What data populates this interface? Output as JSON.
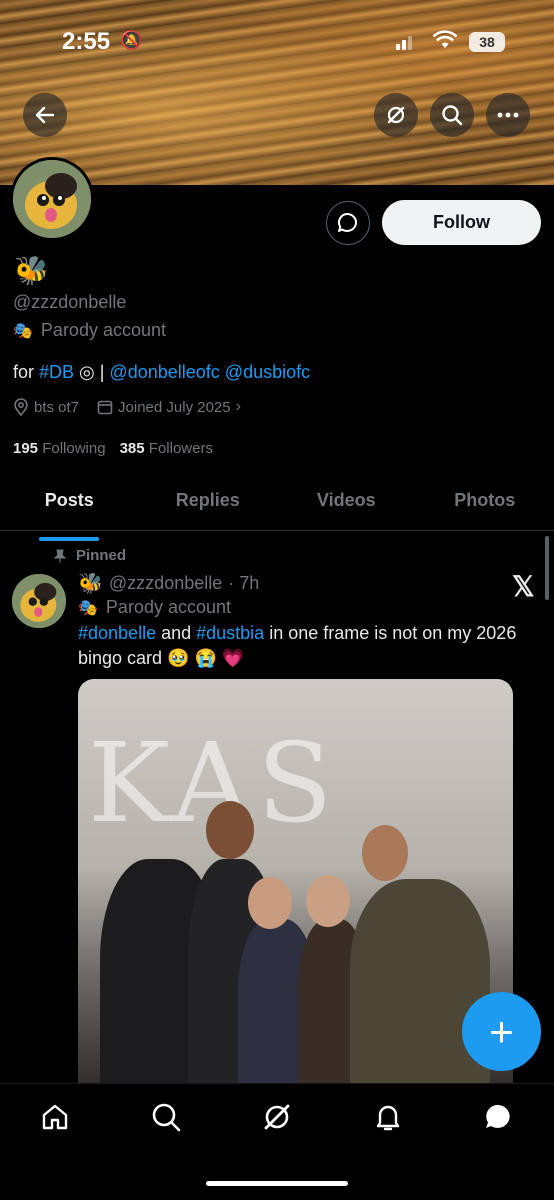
{
  "status": {
    "time": "2:55",
    "battery": "38"
  },
  "profile": {
    "display_emoji": "🐝",
    "handle": "@zzzdonbelle",
    "parody_label": "Parody account",
    "bio_prefix": "for ",
    "bio_hashtag": "#DB",
    "bio_sep": " ◎ | ",
    "bio_mention1": "@donbelleofc",
    "bio_mention2": "@dusbiofc",
    "location": "bts ot7",
    "joined": "Joined July 2025",
    "following_count": "195",
    "following_label": "Following",
    "followers_count": "385",
    "followers_label": "Followers",
    "follow_label": "Follow"
  },
  "tabs": [
    {
      "label": "Posts"
    },
    {
      "label": "Replies"
    },
    {
      "label": "Videos"
    },
    {
      "label": "Photos"
    }
  ],
  "tweet": {
    "pinned_label": "Pinned",
    "emoji": "🐝",
    "handle": "@zzzdonbelle",
    "time": "· 7h",
    "parody_label": "Parody account",
    "hashtag1": "#donbelle",
    "and": " and ",
    "hashtag2": "#dustbia",
    "text_rest": " in one frame is not on my 2026 bingo card 🥹 😭 💗",
    "photo_overlay_text": "KAS"
  },
  "fab_label": "+",
  "colors": {
    "accent": "#1d9bf0",
    "background": "#000000",
    "muted": "#71767b"
  },
  "icons": [
    "back-arrow-icon",
    "grok-icon",
    "search-icon",
    "more-icon",
    "message-icon",
    "location-icon",
    "calendar-icon",
    "chevron-right-icon",
    "pin-icon",
    "x-logo-icon",
    "home-icon",
    "search-nav-icon",
    "grok-nav-icon",
    "notifications-icon",
    "messages-icon"
  ]
}
